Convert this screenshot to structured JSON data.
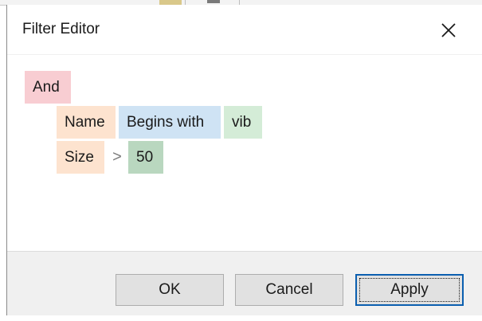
{
  "dialog": {
    "title": "Filter Editor",
    "close_icon": "close-icon"
  },
  "filter": {
    "group_operator": "And",
    "conditions": [
      {
        "field": "Name",
        "operator": "Begins with",
        "value": "vib"
      },
      {
        "field": "Size",
        "operator": ">",
        "value": "50"
      }
    ]
  },
  "buttons": {
    "ok": "OK",
    "cancel": "Cancel",
    "apply": "Apply"
  },
  "colors": {
    "group_tag": "#f8cdd2",
    "field_tag": "#fde3cf",
    "operator_tag": "#cfe3f4",
    "value_tag": "#d4ecd7",
    "value_tag_selected": "#b9d7bf",
    "default_button_border": "#0b5fb0"
  }
}
